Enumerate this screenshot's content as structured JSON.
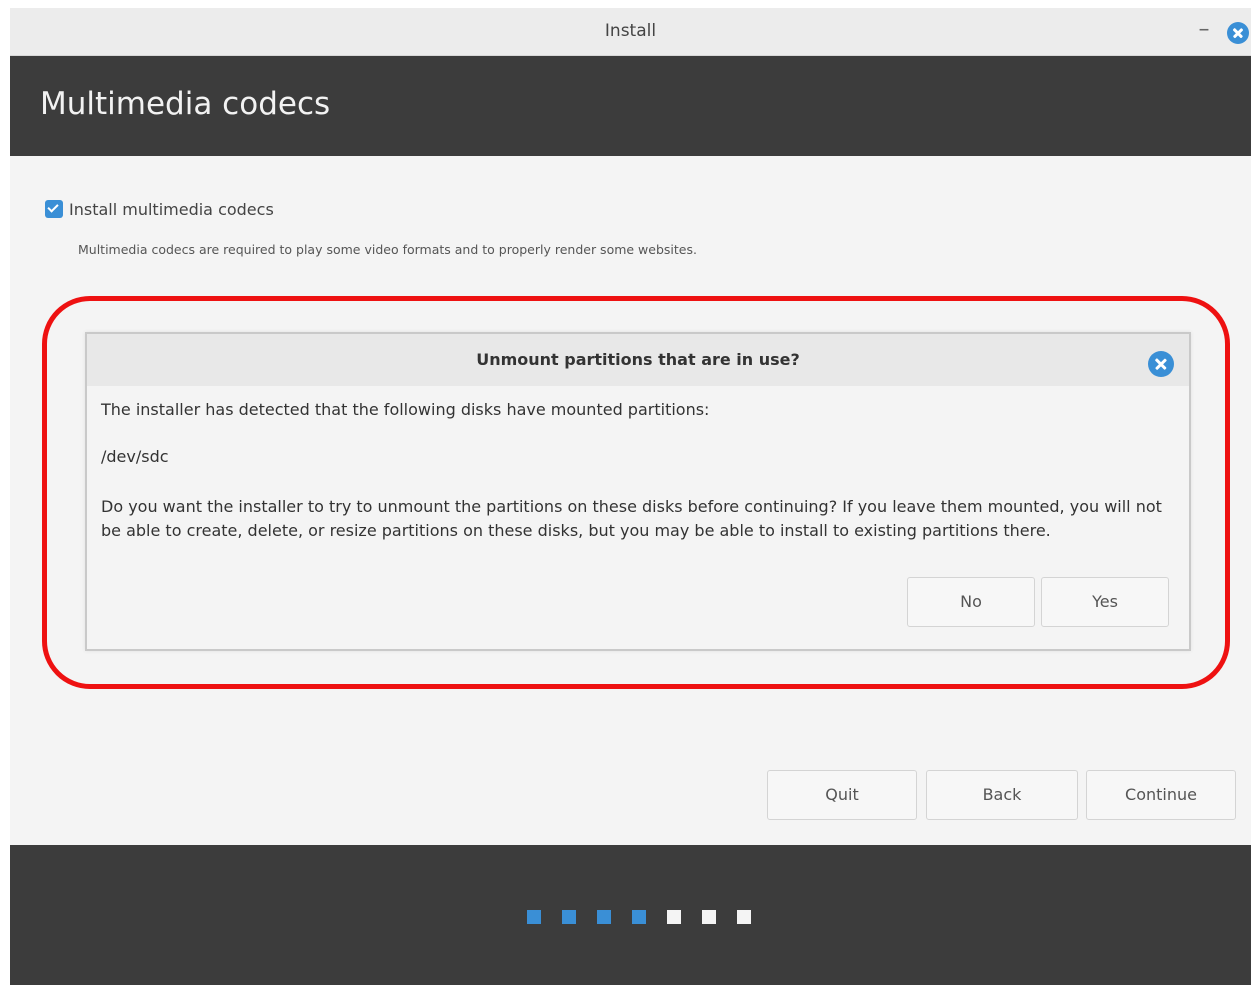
{
  "window": {
    "title": "Install",
    "minimize_label": "–"
  },
  "header": {
    "title": "Multimedia codecs"
  },
  "codecs": {
    "checkbox_label": "Install multimedia codecs",
    "checked": true,
    "description": "Multimedia codecs are required to play some video formats and to properly render some websites."
  },
  "dialog": {
    "title": "Unmount partitions that are in use?",
    "line1": "The installer has detected that the following disks have mounted partitions:",
    "disk": "/dev/sdc",
    "question": "Do you want the installer to try to unmount the partitions on these disks before continuing?  If you leave them mounted, you will not be able to create, delete, or resize partitions on these disks, but you may be able to install to existing partitions there.",
    "no_label": "No",
    "yes_label": "Yes"
  },
  "nav": {
    "quit_label": "Quit",
    "back_label": "Back",
    "continue_label": "Continue"
  },
  "progress": {
    "steps_total": 7,
    "steps_completed": 4
  },
  "colors": {
    "accent": "#3a8fd6",
    "highlight": "#ee1111",
    "header_bg": "#3c3c3c"
  }
}
